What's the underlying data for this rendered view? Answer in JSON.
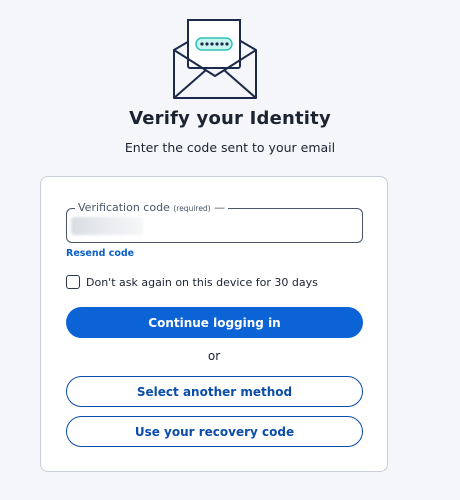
{
  "header": {
    "title": "Verify your Identity",
    "subtitle": "Enter the code sent to your email",
    "icon": "envelope-code-icon"
  },
  "form": {
    "code_label": "Verification code",
    "code_required": "(required)",
    "resend_label": "Resend code",
    "remember_label": "Don't ask again on this device for 30 days",
    "remember_checked": false,
    "continue_label": "Continue logging in",
    "or_label": "or",
    "method_label": "Select another method",
    "recovery_label": "Use your recovery code"
  },
  "colors": {
    "primary": "#0b63d6",
    "outline": "#0b4da8",
    "accent": "#2ec4b6",
    "background": "#f4f6f9"
  }
}
